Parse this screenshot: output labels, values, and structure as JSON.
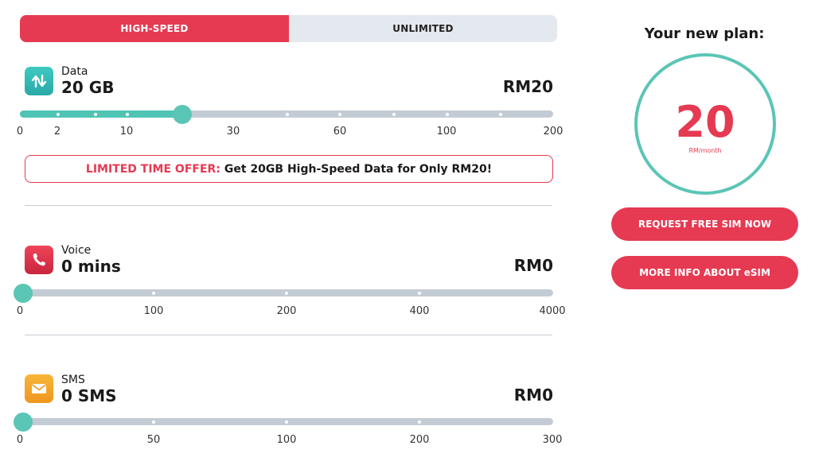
{
  "tabs": [
    {
      "label": "HIGH-SPEED",
      "active": true
    },
    {
      "label": "UNLIMITED",
      "active": false
    }
  ],
  "data": {
    "icon": "up-down-arrows-icon",
    "name": "Data",
    "amount": "20 GB",
    "price": "RM20",
    "ticks": [
      "0",
      "2",
      "10",
      "30",
      "60",
      "100",
      "200"
    ],
    "selected_level": 0.305
  },
  "offer": {
    "highlight": "LIMITED TIME OFFER:",
    "text": "Get 20GB High-Speed Data for Only RM20!"
  },
  "voice": {
    "icon": "phone-icon",
    "name": "Voice",
    "amount": "0 mins",
    "price": "RM0",
    "ticks": [
      "0",
      "100",
      "200",
      "400",
      "4000"
    ],
    "selected_level": 0
  },
  "sms": {
    "icon": "envelope-icon",
    "name": "SMS",
    "amount": "0 SMS",
    "price": "RM0",
    "ticks": [
      "0",
      "50",
      "100",
      "200",
      "300"
    ],
    "selected_level": 0
  },
  "plan": {
    "title": "Your new plan:",
    "value": "20",
    "unit": "RM/month"
  },
  "buttons": {
    "request_sim": "REQUEST FREE SIM NOW",
    "esim_info": "MORE INFO ABOUT eSIM"
  },
  "colors": {
    "accent_red": "#e63a52",
    "accent_teal": "#5bc5b6",
    "track_grey": "#c3ccd4"
  }
}
